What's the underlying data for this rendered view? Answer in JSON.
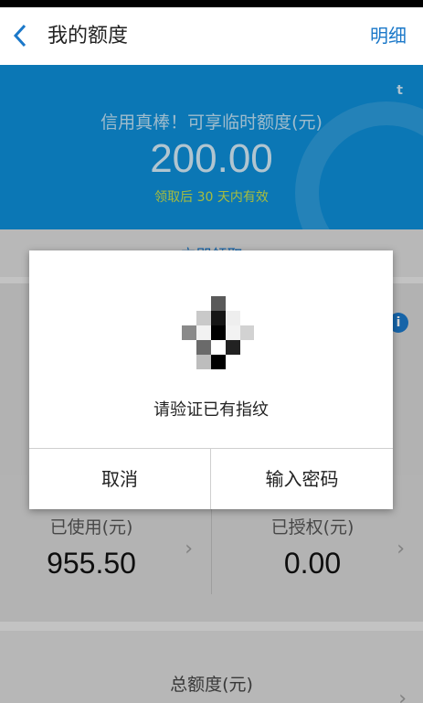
{
  "header": {
    "title": "我的额度",
    "detail_label": "明细"
  },
  "banner": {
    "corner_text": "t",
    "temp_credit_text": "信用真棒！可享临时额度(元)",
    "temp_amount": "200.00",
    "valid_text": "领取后 30 天内有效",
    "accent_color": "#0e8ed8"
  },
  "partial_link": "立即领取",
  "stats": {
    "used_label": "已使用(元)",
    "used_value": "955.50",
    "authorized_label": "已授权(元)",
    "authorized_value": "0.00"
  },
  "total": {
    "label": "总额度(元)"
  },
  "dialog": {
    "icon": "fingerprint-pixel-icon",
    "prompt": "请验证已有指纹",
    "cancel_label": "取消",
    "password_label": "输入密码"
  },
  "icons": {
    "back": "chevron-left-icon",
    "info": "info-icon",
    "arrow": "chevron-right-icon"
  }
}
